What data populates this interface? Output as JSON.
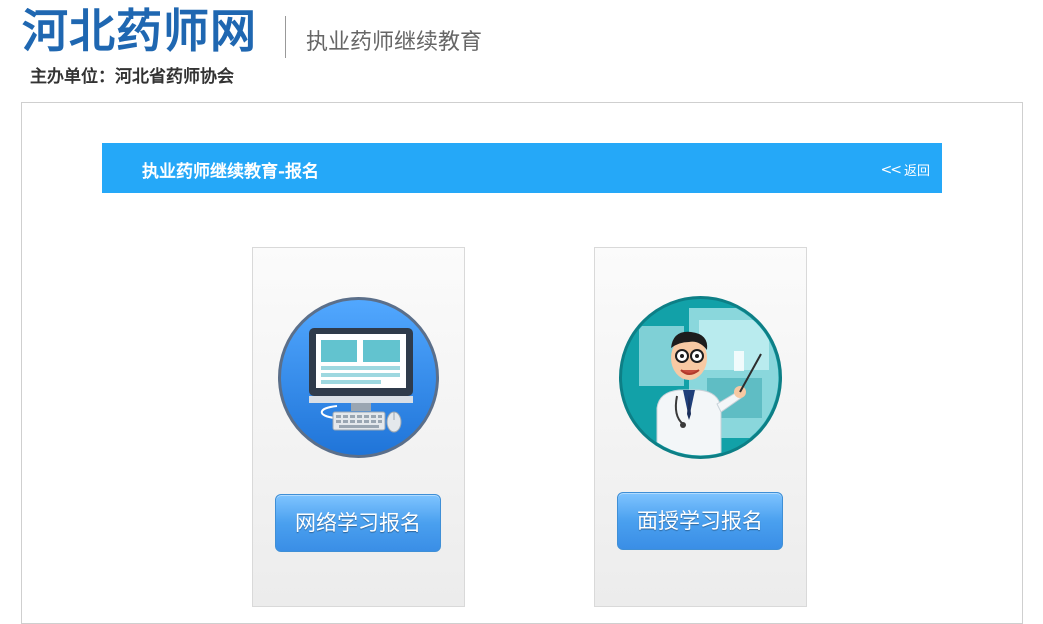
{
  "header": {
    "logo_text": "河北药师网",
    "organizer": "主办单位：河北省药师协会",
    "section_title": "执业药师继续教育"
  },
  "title_bar": {
    "title": "执业药师继续教育-报名",
    "back_label": "返回",
    "back_icon": "double-chevron-left-icon"
  },
  "cards": [
    {
      "illustration": "computer-monitor-icon",
      "button_label": "网络学习报名"
    },
    {
      "illustration": "doctor-teaching-icon",
      "button_label": "面授学习报名"
    }
  ],
  "colors": {
    "logo": "#1f67b1",
    "title_bar": "#25a8f8",
    "button": "#4aa0ef",
    "computer_circle": "#2f86ea",
    "doctor_circle": "#12a1a8"
  }
}
